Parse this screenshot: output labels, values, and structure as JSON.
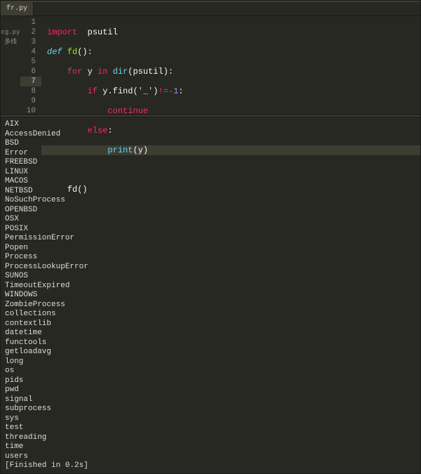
{
  "tabs": {
    "active": "fr.py",
    "inactive_1": "cg.py",
    "inactive_2": "多线"
  },
  "gutter": {
    "1": "1",
    "2": "2",
    "3": "3",
    "4": "4",
    "5": "5",
    "6": "6",
    "7": "7",
    "8": "8",
    "9": "9",
    "10": "10"
  },
  "code": {
    "l1": {
      "import": "import",
      "sp": "  ",
      "mod": "psutil"
    },
    "l2": {
      "def": "def",
      "name": "fd",
      "paren_o": "(",
      "paren_c": ")",
      "colon": ":"
    },
    "l3": {
      "indent": "    ",
      "for": "for",
      "var": "y",
      "in": "in",
      "dir": "dir",
      "po": "(",
      "arg": "psutil",
      "pc": ")",
      "colon": ":"
    },
    "l4": {
      "indent": "        ",
      "if": "if",
      "obj": "y",
      "dot": ".",
      "method": "find",
      "po": "(",
      "str": "'_'",
      "pc": ")",
      "op": "!=-",
      "num": "1",
      "colon": ":"
    },
    "l5": {
      "indent": "            ",
      "continue": "continue"
    },
    "l6": {
      "indent": "        ",
      "else": "else",
      "colon": ":"
    },
    "l7": {
      "indent": "            ",
      "print": "print",
      "po": "(",
      "arg": "y",
      "pc": ")"
    },
    "l8": {
      "blank": ""
    },
    "l9": {
      "indent": "    ",
      "call": "fd",
      "po": "(",
      "pc": ")"
    },
    "l10": {
      "blank": ""
    }
  },
  "output": {
    "lines": [
      "AIX",
      "AccessDenied",
      "BSD",
      "Error",
      "FREEBSD",
      "LINUX",
      "MACOS",
      "NETBSD",
      "NoSuchProcess",
      "OPENBSD",
      "OSX",
      "POSIX",
      "PermissionError",
      "Popen",
      "Process",
      "ProcessLookupError",
      "SUNOS",
      "TimeoutExpired",
      "WINDOWS",
      "ZombieProcess",
      "collections",
      "contextlib",
      "datetime",
      "functools",
      "getloadavg",
      "long",
      "os",
      "pids",
      "pwd",
      "signal",
      "subprocess",
      "sys",
      "test",
      "threading",
      "time",
      "users",
      "[Finished in 0.2s]"
    ]
  }
}
